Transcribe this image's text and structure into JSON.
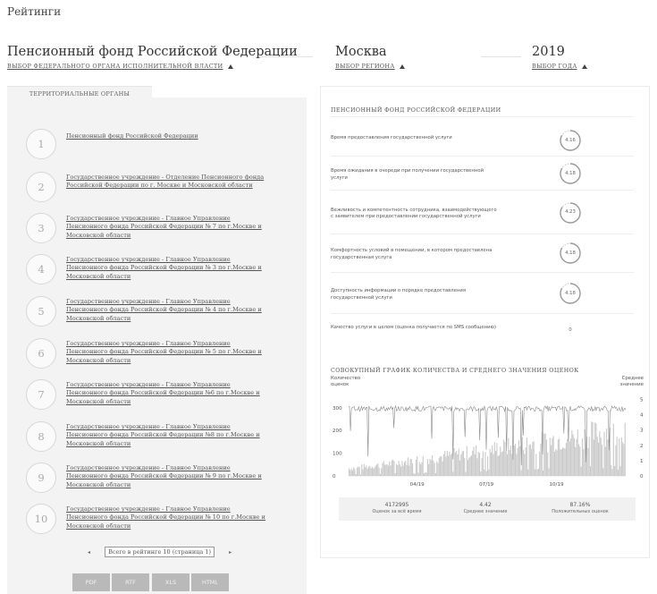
{
  "page_title": "Рейтинги",
  "federal": {
    "value": "Пенсионный фонд Российской Федерации",
    "link": "ВЫБОР ФЕДЕРАЛЬНОГО ОРГАНА ИСПОЛНИТЕЛЬНОЙ ВЛАСТИ"
  },
  "region": {
    "value": "Москва",
    "link": "ВЫБОР РЕГИОНА"
  },
  "year": {
    "value": "2019",
    "link": "ВЫБОР ГОДА"
  },
  "left": {
    "tab": "ТЕРРИТОРИАЛЬНЫЕ ОРГАНЫ",
    "orgs": [
      {
        "num": "1",
        "name": "Пенсионный фонд Российской Федерации"
      },
      {
        "num": "2",
        "name": "Государственное учреждение - Отделение Пенсионного фонда Российской Федерации по г. Москве и Московской области"
      },
      {
        "num": "3",
        "name": "Государственное учреждение - Главное Управление Пенсионного фонда Российской Федерации № 7 по г.Москве и Московской области"
      },
      {
        "num": "4",
        "name": "Государственное учреждение - Главное Управление Пенсионного фонда Российской Федерации № 3 по г.Москве и Московской области"
      },
      {
        "num": "5",
        "name": "Государственное учреждение - Главное Управление Пенсионного фонда Российской Федерации № 4 по г.Москве и Московской области"
      },
      {
        "num": "6",
        "name": "Государственное учреждение - Главное Управление Пенсионного фонда Российской Федерации № 5 по г.Москве и Московской области"
      },
      {
        "num": "7",
        "name": "Государственное учреждение - Главное Управление Пенсионного фонда Российской Федерации №6 по г.Москве и Московской области"
      },
      {
        "num": "8",
        "name": "Государственное учреждение - Главное Управление Пенсионного фонда Российской Федерации №8 по г.Москве и Московской области"
      },
      {
        "num": "9",
        "name": "Государственное учреждение - Главное Управление Пенсионного фонда Российской Федерации № 9 по г.Москве и Московской области"
      },
      {
        "num": "10",
        "name": "Государственное учреждение - Главное Управление Пенсионного фонда Российской Федерации № 10 по г.Москве и Московской области"
      }
    ],
    "pager": {
      "prev": "◂",
      "info": "Всего в рейтинге 10 (страница 1)",
      "next": "▸"
    },
    "exports": [
      "PDF",
      "RTF",
      "XLS",
      "HTML"
    ]
  },
  "right": {
    "section_title": "ПЕНСИОННЫЙ ФОНД РОССИЙСКОЙ ФЕДЕРАЦИИ",
    "criteria": [
      {
        "label": "Время предоставления государственной услуги",
        "value": "4.16",
        "score": 4.16
      },
      {
        "label": "Время ожидания в очереди при получении государственной услуги",
        "value": "4.18",
        "score": 4.18
      },
      {
        "label": "Вежливость и компетентность сотрудника, взаимодействующего с заявителем при предоставлении государственной услуги",
        "value": "4.23",
        "score": 4.23
      },
      {
        "label": "Комфортность условий в помещении, в котором предоставлена государственная услуга",
        "value": "4.18",
        "score": 4.18
      },
      {
        "label": "Доступность информации о порядке предоставления государственной услуги",
        "value": "4.18",
        "score": 4.18
      },
      {
        "label": "Качество услуги в целом (оценка получается по SMS сообщению)",
        "value": "0",
        "score": 0
      }
    ],
    "chart_title": "СОВОКУПНЫЙ ГРАФИК КОЛИЧЕСТВА И СРЕДНЕГО ЗНАЧЕНИЯ ОЦЕНОК",
    "summary": [
      {
        "value": "4172995",
        "label": "Оценок за всё время"
      },
      {
        "value": "4.42",
        "label": "Среднее значение"
      },
      {
        "value": "87.16%",
        "label": "Положительных оценок"
      }
    ]
  },
  "colors": {
    "panel_bg": "#f3f3f3",
    "bar": "#c9c9c9",
    "line": "#8a8a8a",
    "button": "#b9b9b9"
  },
  "icons": {
    "dropdown": "triangle-up-icon"
  },
  "chart_data": {
    "type": "bar",
    "title": "СОВОКУПНЫЙ ГРАФИК КОЛИЧЕСТВА И СРЕДНЕГО ЗНАЧЕНИЯ ОЦЕНОК",
    "ylabel_left": "Количество оценок",
    "ylabel_right": "Среднее значение",
    "xticks": [
      "04/19",
      "07/19",
      "10/19"
    ],
    "yticks_left": [
      "0",
      "100",
      "200",
      "300"
    ],
    "yticks_right": [
      "0",
      "1",
      "2",
      "3",
      "4",
      "5"
    ],
    "ylim_left": [
      0,
      370
    ],
    "ylim_right": [
      0,
      5.5
    ],
    "xlim_days": [
      1,
      365
    ],
    "xtick_days": [
      91,
      182,
      274
    ],
    "grid": false,
    "series": [
      {
        "name": "Количество оценок",
        "kind": "bar",
        "days": [
          1,
          365
        ],
        "level_start": 40,
        "level_end": 250
      },
      {
        "name": "Среднее значение",
        "kind": "line",
        "days": [
          1,
          365
        ],
        "level": 4.4
      }
    ]
  }
}
